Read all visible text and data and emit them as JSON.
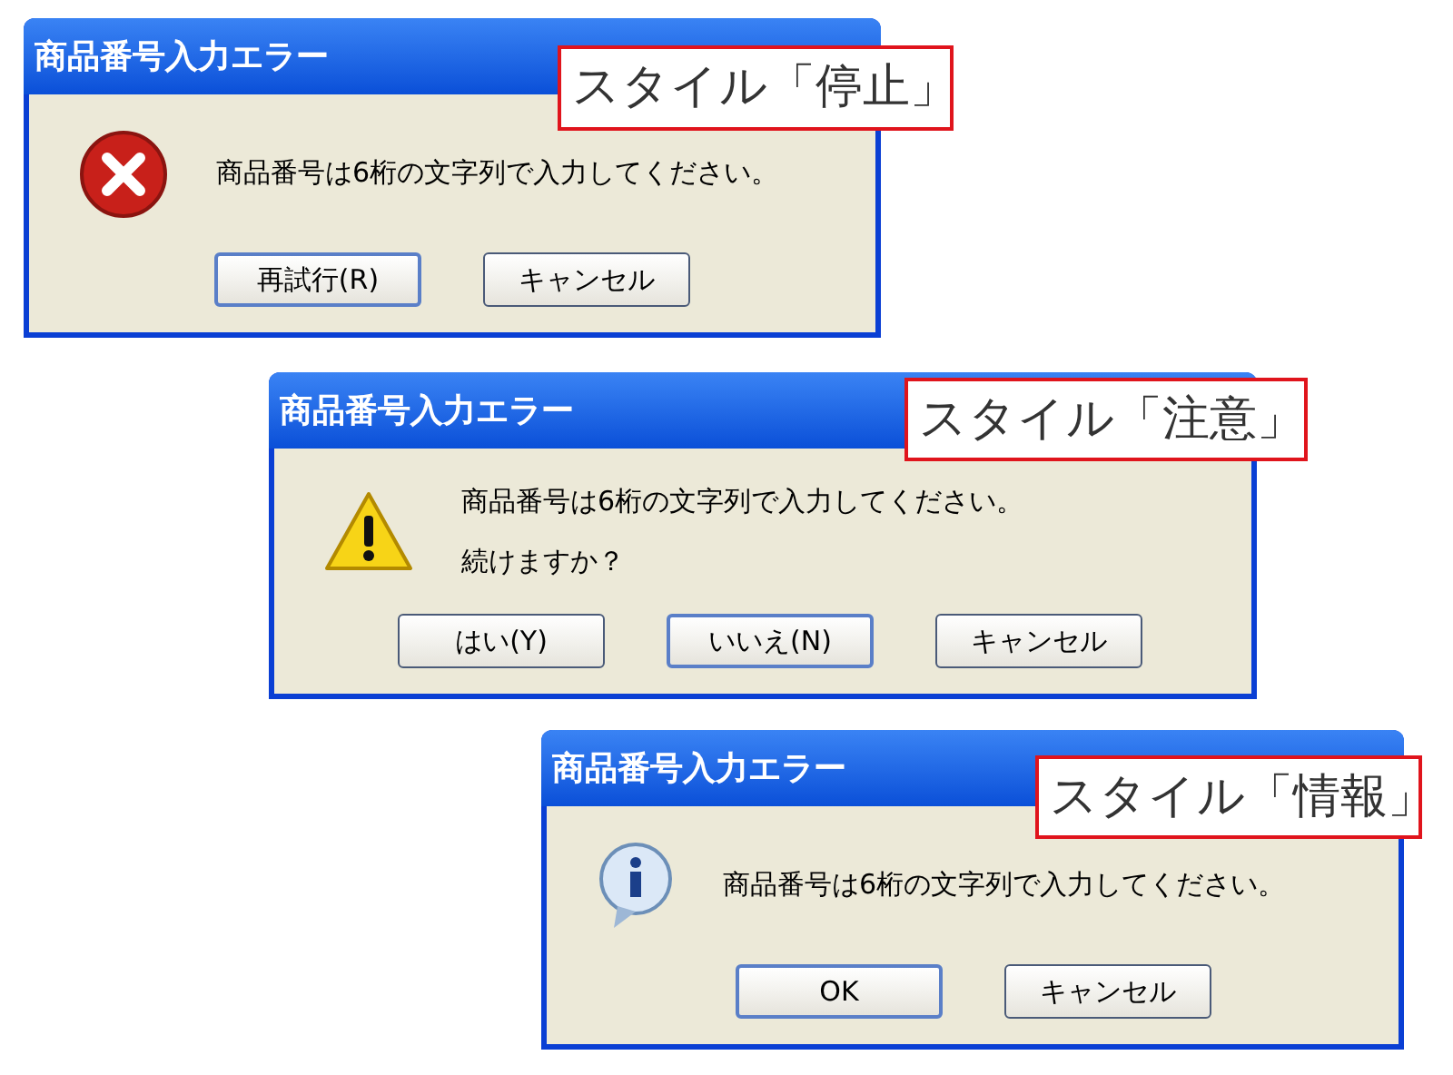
{
  "dialogs": [
    {
      "title": "商品番号入力エラー",
      "kind": "error",
      "messages": [
        "商品番号は6桁の文字列で入力してください。"
      ],
      "buttons": [
        {
          "label": "再試行(R)",
          "default": true
        },
        {
          "label": "キャンセル",
          "default": false
        }
      ],
      "caption": "スタイル「停止」"
    },
    {
      "title": "商品番号入力エラー",
      "kind": "warning",
      "messages": [
        "商品番号は6桁の文字列で入力してください。",
        "続けますか？"
      ],
      "buttons": [
        {
          "label": "はい(Y)",
          "default": false
        },
        {
          "label": "いいえ(N)",
          "default": true
        },
        {
          "label": "キャンセル",
          "default": false
        }
      ],
      "caption": "スタイル「注意」"
    },
    {
      "title": "商品番号入力エラー",
      "kind": "info",
      "messages": [
        "商品番号は6桁の文字列で入力してください。"
      ],
      "buttons": [
        {
          "label": "OK",
          "default": true
        },
        {
          "label": "キャンセル",
          "default": false
        }
      ],
      "caption": "スタイル「情報」"
    }
  ]
}
